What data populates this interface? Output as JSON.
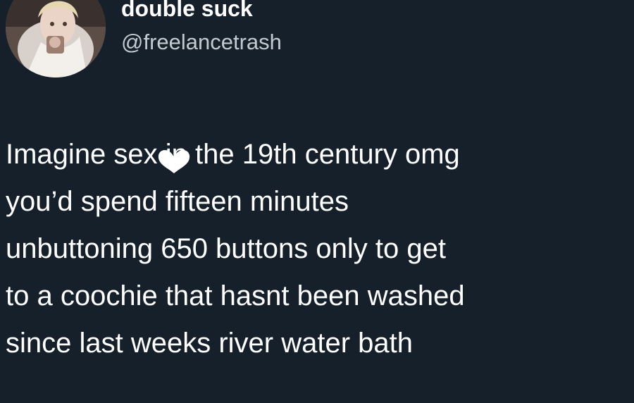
{
  "author": {
    "display_name": "double suck",
    "handle": "@freelancetrash",
    "avatar_icon": "profile-photo"
  },
  "tweet": {
    "lines": [
      "Imagine sex in the 19th century omg",
      "you’d spend fifteen minutes",
      "unbuttoning 650 buttons only to get",
      "to a coochie that hasnt been washed",
      "since last weeks river water bath"
    ]
  },
  "colors": {
    "background": "#16202b",
    "text": "#ffffff",
    "handle": "#c2cad2"
  },
  "overlay_icon": "heart-cursor-icon"
}
